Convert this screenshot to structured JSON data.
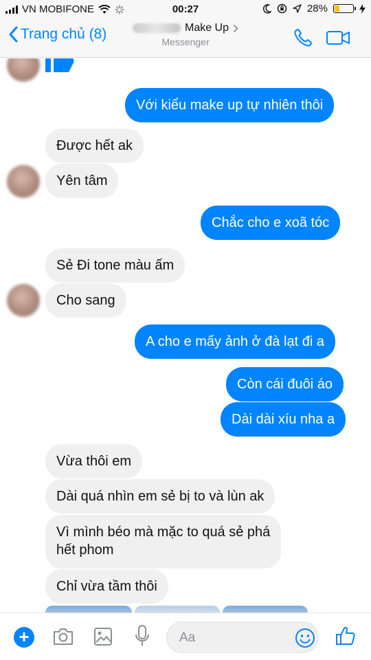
{
  "status_bar": {
    "carrier": "VN MOBIFONE",
    "time": "00:27",
    "battery_percent": "28%",
    "battery_level": 0.28,
    "icons": [
      "signal-icon",
      "wifi-icon",
      "loading-icon",
      "moon-icon",
      "rotation-lock-icon",
      "location-icon",
      "battery-icon",
      "charging-icon"
    ]
  },
  "header": {
    "back_label": "Trang chủ (8)",
    "title": "Make Up",
    "subtitle": "Messenger",
    "accent_color": "#0084ff"
  },
  "messages": [
    {
      "side": "out",
      "text": "Với kiểu make up tự nhiên thôi"
    },
    {
      "side": "in",
      "text": "Được hết ak"
    },
    {
      "side": "in",
      "text": "Yên tâm"
    },
    {
      "side": "out",
      "text": "Chắc cho e xoã tóc"
    },
    {
      "side": "in",
      "text": "Sẻ Đi tone màu ấm"
    },
    {
      "side": "in",
      "text": "Cho sang"
    },
    {
      "side": "out",
      "text": "A cho e mấy ảnh ở đà lạt đi a"
    },
    {
      "side": "out",
      "text": "Còn cái đuôi áo"
    },
    {
      "side": "out",
      "text": "Dài dài xíu nha a"
    },
    {
      "side": "in",
      "text": "Vừa thôi em"
    },
    {
      "side": "in",
      "text": "Dài quá nhìn em sẻ bị to và lùn ak"
    },
    {
      "side": "in",
      "text": "Vì mình béo mà mặc to quá sẻ phá"
    },
    {
      "side": "in",
      "text": "hết phom"
    },
    {
      "side": "in",
      "text": "Chỉ vừa tầm thôi"
    }
  ],
  "colors": {
    "outgoing_bubble": "#0084ff",
    "incoming_bubble": "#f1f0f0"
  },
  "composer": {
    "placeholder": "Aa",
    "icons": [
      "plus-icon",
      "camera-icon",
      "image-icon",
      "microphone-icon",
      "emoji-icon",
      "like-icon"
    ]
  }
}
